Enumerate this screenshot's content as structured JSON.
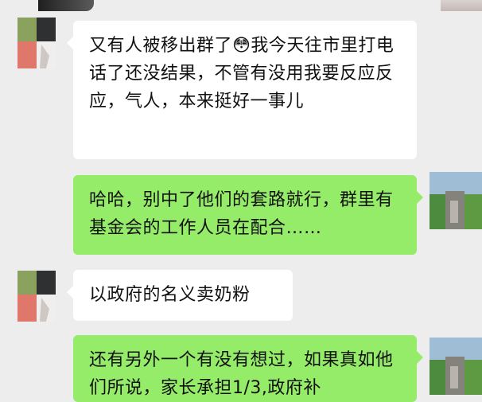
{
  "conversation": {
    "messages": [
      {
        "side": "left",
        "text": "又有人被移出群了😳我今天往市里打电话了还没结果，不管有没用我要反应反应，气人，本来挺好一事儿"
      },
      {
        "side": "right",
        "text": "哈哈，别中了他们的套路就行，群里有基金会的工作人员在配合……"
      },
      {
        "side": "left",
        "text": "以政府的名义卖奶粉"
      },
      {
        "side": "right",
        "text": "还有另外一个有没有想过，如果真如他们所说，家长承担1/3,政府补"
      }
    ]
  }
}
